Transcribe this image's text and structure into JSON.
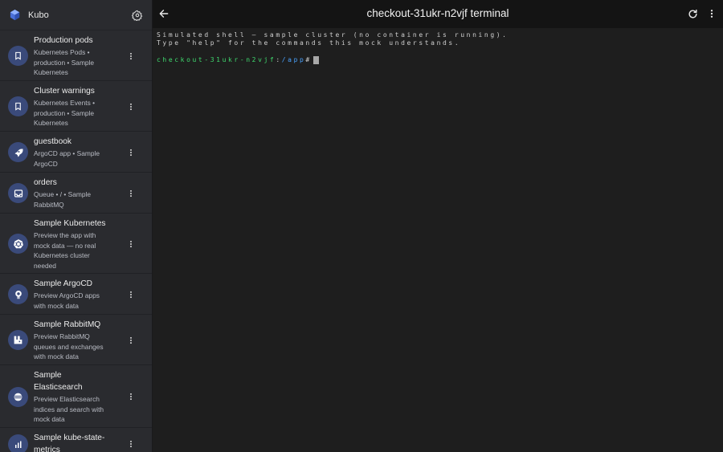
{
  "app": {
    "name": "Kubo"
  },
  "sidebar": {
    "items": [
      {
        "title": "Production pods",
        "sub": [
          "Kubernetes Pods •",
          "production • Sample",
          "Kubernetes"
        ],
        "icon": "bookmark-icon"
      },
      {
        "title": "Cluster warnings",
        "sub": [
          "Kubernetes Events •",
          "production • Sample",
          "Kubernetes"
        ],
        "icon": "bookmark-icon"
      },
      {
        "title": "guestbook",
        "sub": [
          "ArgoCD app • Sample",
          "ArgoCD"
        ],
        "icon": "rocket-icon"
      },
      {
        "title": "orders",
        "sub": [
          "Queue • / • Sample",
          "RabbitMQ"
        ],
        "icon": "inbox-icon"
      },
      {
        "title": "Sample Kubernetes",
        "sub": [
          "Preview the app with",
          "mock data — no real",
          "Kubernetes cluster",
          "needed"
        ],
        "icon": "kubernetes-icon"
      },
      {
        "title": "Sample ArgoCD",
        "sub": [
          "Preview ArgoCD apps",
          "with mock data"
        ],
        "icon": "argocd-icon"
      },
      {
        "title": "Sample RabbitMQ",
        "sub": [
          "Preview RabbitMQ",
          "queues and exchanges",
          "with mock data"
        ],
        "icon": "rabbitmq-icon"
      },
      {
        "title": "Sample\nElasticsearch",
        "sub": [
          "Preview Elasticsearch",
          "indices and search with",
          "mock data"
        ],
        "icon": "elasticsearch-icon"
      },
      {
        "title": "Sample kube-state-\nmetrics",
        "sub": [],
        "icon": "metrics-icon"
      }
    ]
  },
  "header": {
    "title": "checkout-31ukr-n2vjf terminal"
  },
  "terminal": {
    "lines": [
      "Simulated shell — sample cluster (no container is running).",
      "Type \"help\" for the commands this mock understands."
    ],
    "prompt": {
      "host": "checkout-31ukr-n2vjf",
      "sep": ":",
      "path": "/app",
      "hash": "#"
    }
  },
  "colors": {
    "accent": "#3a4a7a",
    "prompt_host": "#3fd96e",
    "prompt_path": "#4aa3ff"
  }
}
